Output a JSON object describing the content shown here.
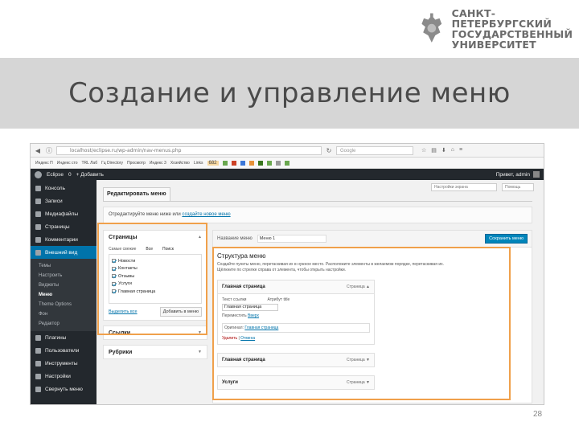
{
  "logo": {
    "lines": [
      "САНКТ-ПЕТЕРБУРГСКИЙ",
      "ГОСУДАРСТВЕННЫЙ",
      "УНИВЕРСИТЕТ"
    ],
    "icon": "double-headed-eagle-emblem"
  },
  "title": "Создание и управление меню",
  "page_number": "28",
  "colors": {
    "highlight": "#f0a04b",
    "admin_bar": "#23282d",
    "accent": "#0073aa",
    "button": "#0085ba"
  },
  "browser": {
    "url": "localhost/eclipse.ru/wp-admin/nav-menus.php",
    "search_placeholder": "Google"
  },
  "bookmarks": [
    "Индекс П",
    "Индекс сто",
    "TRL Лаб",
    "Гц Directory",
    "Просмотр",
    "Индекс 3",
    "Хозяйство",
    "Links"
  ],
  "bookmark_badge": "682",
  "admin_bar": {
    "site": "Eclipse",
    "new_count": "0",
    "add_new": "Добавить",
    "greeting": "Привет, admin"
  },
  "sidebar": {
    "items": [
      "Консоль",
      "Записи",
      "Медиафайлы",
      "Страницы",
      "Комментарии",
      "Внешний вид"
    ],
    "subitems": [
      "Темы",
      "Настроить",
      "Виджеты",
      "Меню",
      "Theme Options",
      "Фон",
      "Редактор"
    ],
    "bottom": [
      "Плагины",
      "Пользователи",
      "Инструменты",
      "Настройки",
      "Свернуть меню"
    ]
  },
  "screen_options": "Настройки экрана",
  "help": "Помощь",
  "tab_edit": "Редактировать меню",
  "select_text": "Отредактируйте меню ниже или",
  "select_link": "создайте новое меню",
  "pages_panel": {
    "title": "Страницы",
    "tabs": [
      "Самые свежие",
      "Все",
      "Поиск"
    ],
    "items": [
      "Новости",
      "Контакты",
      "Отзывы",
      "Услуги",
      "Главная страница"
    ],
    "select_all": "Выделить все",
    "add_button": "Добавить в меню"
  },
  "links_panel": "Ссылки",
  "rubrics_panel": "Рубрики",
  "menu_name_label": "Название меню",
  "menu_name_value": "Меню 1",
  "save_button": "Сохранить меню",
  "structure": {
    "title": "Структура меню",
    "description": "Создайте пункты меню, перетаскивая их в нужное место. Расположите элементы в желаемом порядке, перетаскивая их. Щёлкните по стрелке справа от элемента, чтобы открыть настройки."
  },
  "menu_item": {
    "label": "Главная страница",
    "type": "Страница",
    "nav_label": "Текст ссылки",
    "title_attr": "Атрибут title",
    "value": "Главная страница",
    "move": "Переместить",
    "move_link": "Вверх",
    "original": "Оригинал:",
    "original_link": "Главная страница",
    "delete": "Удалить",
    "cancel": "Отмена"
  },
  "menu_item2": {
    "label": "Главная страница",
    "type": "Страница"
  },
  "menu_item3": {
    "label": "Услуги",
    "type": "Страница"
  }
}
